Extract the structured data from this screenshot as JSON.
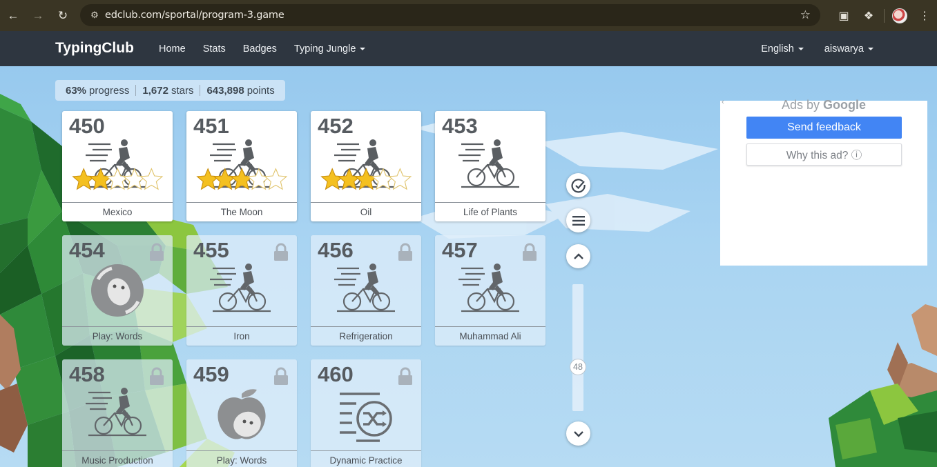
{
  "browser": {
    "url": "edclub.com/sportal/program-3.game"
  },
  "header": {
    "brand": "TypingClub",
    "nav": [
      "Home",
      "Stats",
      "Badges",
      "Typing Jungle"
    ],
    "language": "English",
    "user": "aiswarya"
  },
  "progress": {
    "percent": "63%",
    "percent_label": "progress",
    "stars": "1,672",
    "stars_label": "stars",
    "points": "643,898",
    "points_label": "points"
  },
  "lessons": [
    {
      "num": "450",
      "title": "Mexico",
      "state": "open",
      "icon": "cyclist-icon",
      "stars": 2
    },
    {
      "num": "451",
      "title": "The Moon",
      "state": "open",
      "icon": "cyclist-icon",
      "stars": 3
    },
    {
      "num": "452",
      "title": "Oil",
      "state": "open",
      "icon": "cyclist-icon",
      "stars": 3
    },
    {
      "num": "453",
      "title": "Life of Plants",
      "state": "open",
      "icon": "cyclist-icon",
      "stars": 0
    },
    {
      "num": "454",
      "title": "Play: Words",
      "state": "locked",
      "icon": "game-face-icon"
    },
    {
      "num": "455",
      "title": "Iron",
      "state": "locked",
      "icon": "cyclist-icon"
    },
    {
      "num": "456",
      "title": "Refrigeration",
      "state": "locked",
      "icon": "cyclist-icon"
    },
    {
      "num": "457",
      "title": "Muhammad Ali",
      "state": "locked",
      "icon": "cyclist-icon"
    },
    {
      "num": "458",
      "title": "Music Production",
      "state": "locked",
      "icon": "cyclist-icon"
    },
    {
      "num": "459",
      "title": "Play: Words",
      "state": "locked",
      "icon": "apple-game-icon"
    },
    {
      "num": "460",
      "title": "Dynamic Practice",
      "state": "locked",
      "icon": "shuffle-icon"
    }
  ],
  "scroller": {
    "value": "48"
  },
  "ad": {
    "ads_by": "Ads by",
    "google": "Google",
    "feedback": "Send feedback",
    "why": "Why this ad? ⓘ"
  }
}
